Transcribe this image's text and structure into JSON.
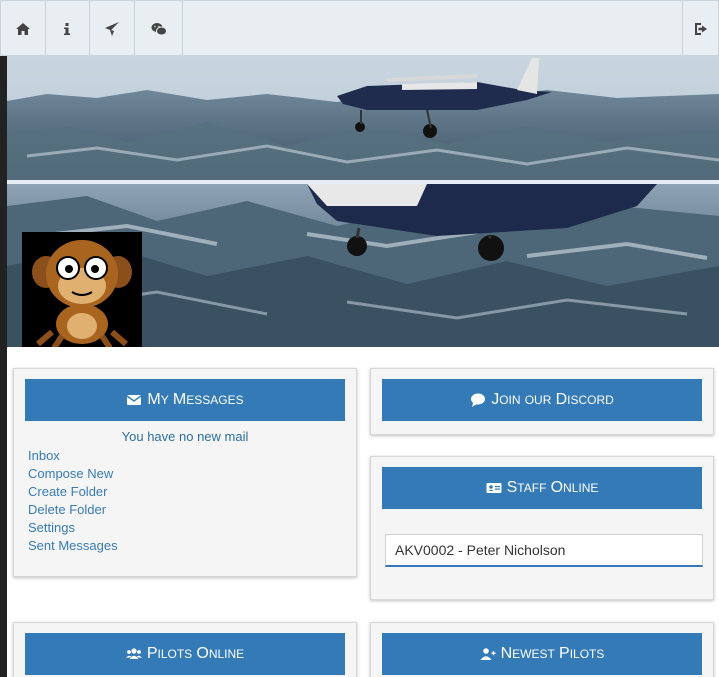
{
  "nav": {
    "items": [
      {
        "icon": "home-icon"
      },
      {
        "icon": "info-icon"
      },
      {
        "icon": "paper-plane-icon"
      },
      {
        "icon": "wechat-icon"
      }
    ],
    "logout_icon": "sign-out-icon"
  },
  "panels": {
    "messages": {
      "title_first": "M",
      "title_first_rest": "y",
      "title_second": "M",
      "title_second_rest": "essages",
      "status": "You have no new mail",
      "links": [
        "Inbox",
        "Compose New",
        "Create Folder",
        "Delete Folder",
        "Settings",
        "Sent Messages"
      ]
    },
    "discord": {
      "w1": "J",
      "w1r": "oin",
      "w2": "our",
      "w3": "D",
      "w3r": "iscord"
    },
    "staff": {
      "w1": "S",
      "w1r": "taff",
      "w2": "O",
      "w2r": "nline",
      "entry": "AKV0002 - Peter Nicholson"
    },
    "pilots_online": {
      "w1": "P",
      "w1r": "ilots",
      "w2": "O",
      "w2r": "nline"
    },
    "newest_pilots": {
      "w1": "N",
      "w1r": "ewest",
      "w2": "P",
      "w2r": "ilots"
    }
  },
  "colors": {
    "accent": "#337ab7",
    "link": "#3a7bb3",
    "nav_bg": "#e9eef3"
  }
}
